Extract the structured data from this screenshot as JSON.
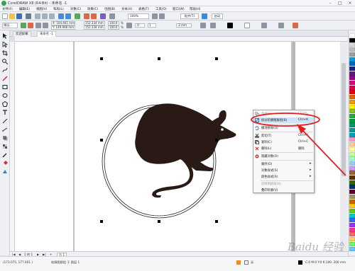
{
  "window": {
    "title": "CorelDRAW X8 (64-Bit) - 未命名 -1",
    "controls": [
      "–",
      "□",
      "×"
    ]
  },
  "menu": [
    "文件(F)",
    "编辑(E)",
    "视图(V)",
    "布局(L)",
    "对象(C)",
    "效果(C)",
    "位图(B)",
    "文本(X)",
    "表格(T)",
    "工具(O)",
    "窗口(W)",
    "帮助(H)"
  ],
  "toolbar": {
    "zoom": "100%",
    "snap_label": "贴齐(T)",
    "launch_label": "启动"
  },
  "property_bar": {
    "preset": "预设...",
    "x": "X: 104.461 mm",
    "y": "Y: 149.908 mm",
    "w": "152.334 mm",
    "h": "152.334 mm",
    "scale_w": "100.0",
    "scale_h": "100.0",
    "pct": "%",
    "angle": ".0",
    "count": "1",
    "outline": ".2 mm"
  },
  "tabs": [
    {
      "label": "欢迎屏幕"
    },
    {
      "label": "未命名 -1"
    }
  ],
  "context_menu": {
    "items": [
      {
        "label": "合并(C)",
        "shortcut": "Ctrl+L",
        "disabled": true
      },
      {
        "label": "拆分轮廓图群组(B)",
        "shortcut": "Ctrl+K",
        "highlight": true
      },
      {
        "label": "撤消移除(U)",
        "shortcut": ""
      },
      {
        "label": "剪切(T)",
        "shortcut": "Ctrl+X"
      },
      {
        "label": "复制(C)",
        "shortcut": "Ctrl+C"
      },
      {
        "label": "删除(L)",
        "shortcut": "删除"
      },
      {
        "label": "隐藏对象(O)",
        "shortcut": ""
      },
      {
        "label": "顺序(O)",
        "shortcut": "",
        "submenu": true
      },
      {
        "label": "对象样式(S)",
        "shortcut": "",
        "submenu": true
      },
      {
        "label": "颜色样式(R)",
        "shortcut": "",
        "submenu": true
      },
      {
        "label": "因特网链接(N)",
        "shortcut": "",
        "disabled": true
      },
      {
        "label": "叠印轮廓(V)",
        "shortcut": ""
      }
    ]
  },
  "page_bar": {
    "position": "1 的 1",
    "page_tab": "页 1"
  },
  "status_bar": {
    "coords": "(173.075, 177.001 )",
    "selection": "轮廓图群组 于 图层 1",
    "fill_info": "无",
    "color_info": "C:0 M:0 Y:0 K:100 .200 mm"
  },
  "watermark": "Baidu 经验",
  "colors": {
    "annotation_red": "#e02020",
    "rat_fill": "#2a1a16",
    "menu_highlight": "#cfe3f7"
  },
  "palette": [
    "#ffffff",
    "#000000",
    "#d9d9d9",
    "#bfbfbf",
    "#9f9f9f",
    "#00a0e9",
    "#0068b7",
    "#1d2088",
    "#601986",
    "#920783",
    "#e4007f",
    "#e5004f",
    "#e60012",
    "#eb6100",
    "#f39800",
    "#fff100",
    "#8fc31f",
    "#22ac38",
    "#009944",
    "#009b6b",
    "#009e96",
    "#00a0c1",
    "#ff99cc",
    "#ffcc99",
    "#ffff99",
    "#ccff99",
    "#99ffcc",
    "#99ccff",
    "#cc99ff",
    "#996633",
    "#663300",
    "#336600",
    "#003366",
    "#660033",
    "#999966",
    "#cc6600",
    "#ffcc00",
    "#66cc00",
    "#00cccc",
    "#3366ff",
    "#9933ff",
    "#ff3399",
    "#ff6666",
    "#ffcc66",
    "#66ff66",
    "#66ccff"
  ]
}
